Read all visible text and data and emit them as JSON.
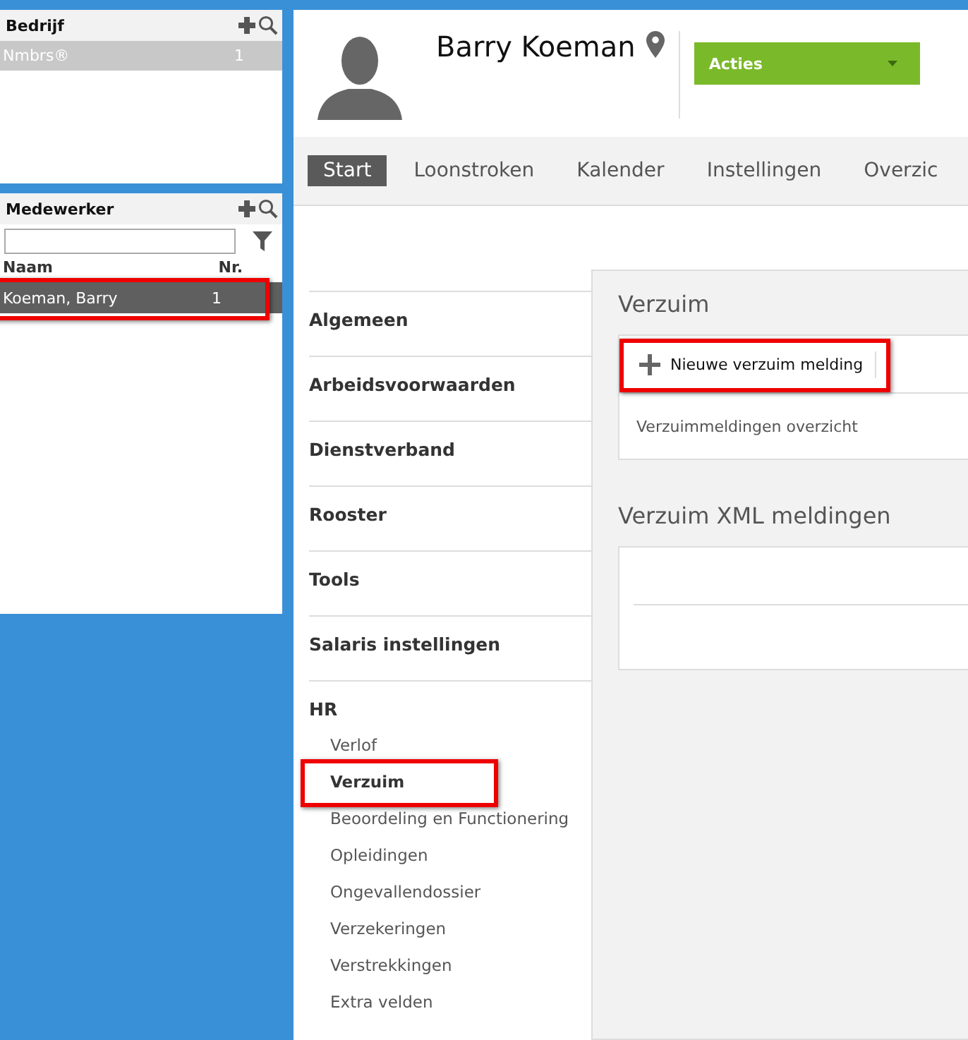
{
  "company_panel": {
    "title": "Bedrijf",
    "rows": [
      {
        "name": "Nmbrs®",
        "count": "1",
        "selected": true
      }
    ]
  },
  "employee_panel": {
    "title": "Medewerker",
    "columns": [
      "Naam",
      "Nr."
    ],
    "rows": [
      {
        "name": "Koeman, Barry",
        "number": "1",
        "selected": true,
        "highlighted": true
      }
    ]
  },
  "header": {
    "name": "Barry Koeman",
    "actions_button": "Acties"
  },
  "tabs": [
    {
      "label": "Start",
      "selected": true
    },
    {
      "label": "Loonstroken",
      "selected": false
    },
    {
      "label": "Kalender",
      "selected": false
    },
    {
      "label": "Instellingen",
      "selected": false
    },
    {
      "label": "Overzic",
      "selected": false
    }
  ],
  "side_menu": [
    {
      "label": "Algemeen"
    },
    {
      "label": "Arbeidsvoorwaarden"
    },
    {
      "label": "Dienstverband"
    },
    {
      "label": "Rooster"
    },
    {
      "label": "Tools"
    },
    {
      "label": "Salaris instellingen"
    },
    {
      "label": "HR",
      "children": [
        {
          "label": "Verlof",
          "selected": false,
          "highlighted": false
        },
        {
          "label": "Verzuim",
          "selected": true,
          "highlighted": true
        },
        {
          "label": "Beoordeling en Functionering",
          "selected": false,
          "highlighted": false
        },
        {
          "label": "Opleidingen",
          "selected": false,
          "highlighted": false
        },
        {
          "label": "Ongevallendossier",
          "selected": false,
          "highlighted": false
        },
        {
          "label": "Verzekeringen",
          "selected": false,
          "highlighted": false
        },
        {
          "label": "Verstrekkingen",
          "selected": false,
          "highlighted": false
        },
        {
          "label": "Extra velden",
          "selected": false,
          "highlighted": false
        }
      ]
    }
  ],
  "content": {
    "section_title": "Verzuim",
    "new_button": {
      "label": "Nieuwe verzuim melding",
      "highlighted": true
    },
    "overview_link": "Verzuimmeldingen overzicht",
    "xml_title": "Verzuim XML meldingen"
  }
}
